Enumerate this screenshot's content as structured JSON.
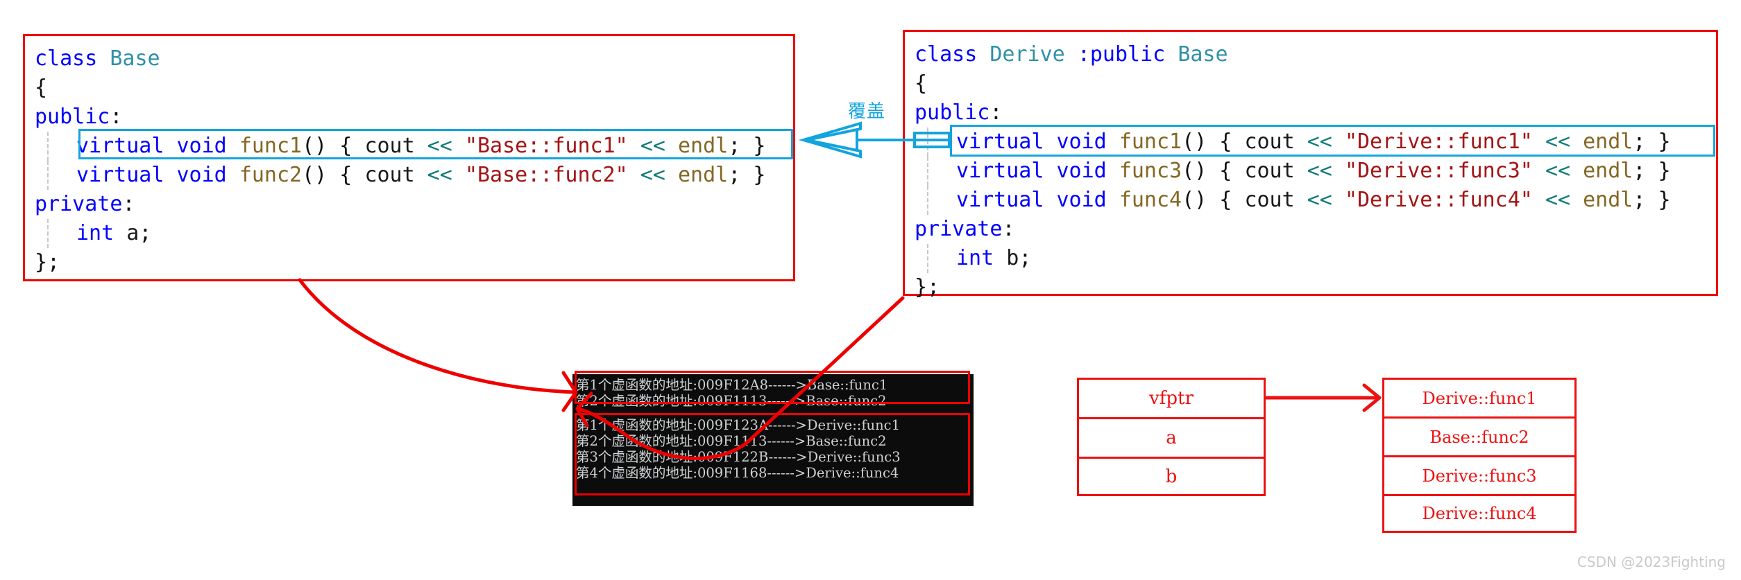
{
  "annotation": {
    "override_label": "覆盖",
    "accent_blue": "#13a4dd",
    "accent_red": "#ee0000"
  },
  "base_class": {
    "title": "class Base",
    "lines": [
      {
        "id": "l1",
        "tokens": [
          {
            "t": "class",
            "c": "kw"
          },
          {
            "t": " ",
            "c": "punc"
          },
          {
            "t": "Base",
            "c": "type"
          }
        ]
      },
      {
        "id": "l2",
        "tokens": [
          {
            "t": "{",
            "c": "punc"
          }
        ]
      },
      {
        "id": "l3",
        "tokens": [
          {
            "t": "public",
            "c": "kw"
          },
          {
            "t": ":",
            "c": "punc"
          }
        ]
      },
      {
        "id": "l4",
        "indent": true,
        "tokens": [
          {
            "t": "virtual",
            "c": "kw"
          },
          {
            "t": " ",
            "c": "punc"
          },
          {
            "t": "void",
            "c": "kw"
          },
          {
            "t": " ",
            "c": "punc"
          },
          {
            "t": "func1",
            "c": "fn"
          },
          {
            "t": "() { ",
            "c": "punc"
          },
          {
            "t": "cout",
            "c": "id"
          },
          {
            "t": " ",
            "c": "punc"
          },
          {
            "t": "<<",
            "c": "op"
          },
          {
            "t": " ",
            "c": "punc"
          },
          {
            "t": "\"Base::func1\"",
            "c": "str"
          },
          {
            "t": " ",
            "c": "punc"
          },
          {
            "t": "<<",
            "c": "op"
          },
          {
            "t": " ",
            "c": "punc"
          },
          {
            "t": "endl",
            "c": "endl"
          },
          {
            "t": "; }",
            "c": "punc"
          }
        ]
      },
      {
        "id": "l5",
        "indent": true,
        "tokens": [
          {
            "t": "virtual",
            "c": "kw"
          },
          {
            "t": " ",
            "c": "punc"
          },
          {
            "t": "void",
            "c": "kw"
          },
          {
            "t": " ",
            "c": "punc"
          },
          {
            "t": "func2",
            "c": "fn"
          },
          {
            "t": "() { ",
            "c": "punc"
          },
          {
            "t": "cout",
            "c": "id"
          },
          {
            "t": " ",
            "c": "punc"
          },
          {
            "t": "<<",
            "c": "op"
          },
          {
            "t": " ",
            "c": "punc"
          },
          {
            "t": "\"Base::func2\"",
            "c": "str"
          },
          {
            "t": " ",
            "c": "punc"
          },
          {
            "t": "<<",
            "c": "op"
          },
          {
            "t": " ",
            "c": "punc"
          },
          {
            "t": "endl",
            "c": "endl"
          },
          {
            "t": "; }",
            "c": "punc"
          }
        ]
      },
      {
        "id": "l6",
        "tokens": [
          {
            "t": "private",
            "c": "kw"
          },
          {
            "t": ":",
            "c": "punc"
          }
        ]
      },
      {
        "id": "l7",
        "indent": true,
        "tokens": [
          {
            "t": "int",
            "c": "kw"
          },
          {
            "t": " ",
            "c": "punc"
          },
          {
            "t": "a",
            "c": "id"
          },
          {
            "t": ";",
            "c": "punc"
          }
        ]
      },
      {
        "id": "l8",
        "tokens": [
          {
            "t": "};",
            "c": "punc"
          }
        ]
      }
    ]
  },
  "derive_class": {
    "title": "class Derive :public Base",
    "lines": [
      {
        "id": "r1",
        "tokens": [
          {
            "t": "class",
            "c": "kw"
          },
          {
            "t": " ",
            "c": "punc"
          },
          {
            "t": "Derive",
            "c": "type"
          },
          {
            "t": " ",
            "c": "punc"
          },
          {
            "t": ":public",
            "c": "kw"
          },
          {
            "t": " ",
            "c": "punc"
          },
          {
            "t": "Base",
            "c": "type"
          }
        ]
      },
      {
        "id": "r2",
        "tokens": [
          {
            "t": "{",
            "c": "punc"
          }
        ]
      },
      {
        "id": "r3",
        "tokens": [
          {
            "t": "public",
            "c": "kw"
          },
          {
            "t": ":",
            "c": "punc"
          }
        ]
      },
      {
        "id": "r4",
        "indent": true,
        "tokens": [
          {
            "t": "virtual",
            "c": "kw"
          },
          {
            "t": " ",
            "c": "punc"
          },
          {
            "t": "void",
            "c": "kw"
          },
          {
            "t": " ",
            "c": "punc"
          },
          {
            "t": "func1",
            "c": "fn"
          },
          {
            "t": "() { ",
            "c": "punc"
          },
          {
            "t": "cout",
            "c": "id"
          },
          {
            "t": " ",
            "c": "punc"
          },
          {
            "t": "<<",
            "c": "op"
          },
          {
            "t": " ",
            "c": "punc"
          },
          {
            "t": "\"Derive::func1\"",
            "c": "str"
          },
          {
            "t": " ",
            "c": "punc"
          },
          {
            "t": "<<",
            "c": "op"
          },
          {
            "t": " ",
            "c": "punc"
          },
          {
            "t": "endl",
            "c": "endl"
          },
          {
            "t": "; }",
            "c": "punc"
          }
        ]
      },
      {
        "id": "r5",
        "indent": true,
        "tokens": [
          {
            "t": "virtual",
            "c": "kw"
          },
          {
            "t": " ",
            "c": "punc"
          },
          {
            "t": "void",
            "c": "kw"
          },
          {
            "t": " ",
            "c": "punc"
          },
          {
            "t": "func3",
            "c": "fn"
          },
          {
            "t": "() { ",
            "c": "punc"
          },
          {
            "t": "cout",
            "c": "id"
          },
          {
            "t": " ",
            "c": "punc"
          },
          {
            "t": "<<",
            "c": "op"
          },
          {
            "t": " ",
            "c": "punc"
          },
          {
            "t": "\"Derive::func3\"",
            "c": "str"
          },
          {
            "t": " ",
            "c": "punc"
          },
          {
            "t": "<<",
            "c": "op"
          },
          {
            "t": " ",
            "c": "punc"
          },
          {
            "t": "endl",
            "c": "endl"
          },
          {
            "t": "; }",
            "c": "punc"
          }
        ]
      },
      {
        "id": "r6",
        "indent": true,
        "tokens": [
          {
            "t": "virtual",
            "c": "kw"
          },
          {
            "t": " ",
            "c": "punc"
          },
          {
            "t": "void",
            "c": "kw"
          },
          {
            "t": " ",
            "c": "punc"
          },
          {
            "t": "func4",
            "c": "fn"
          },
          {
            "t": "() { ",
            "c": "punc"
          },
          {
            "t": "cout",
            "c": "id"
          },
          {
            "t": " ",
            "c": "punc"
          },
          {
            "t": "<<",
            "c": "op"
          },
          {
            "t": " ",
            "c": "punc"
          },
          {
            "t": "\"Derive::func4\"",
            "c": "str"
          },
          {
            "t": " ",
            "c": "punc"
          },
          {
            "t": "<<",
            "c": "op"
          },
          {
            "t": " ",
            "c": "punc"
          },
          {
            "t": "endl",
            "c": "endl"
          },
          {
            "t": "; }",
            "c": "punc"
          }
        ]
      },
      {
        "id": "r7",
        "tokens": [
          {
            "t": "private",
            "c": "kw"
          },
          {
            "t": ":",
            "c": "punc"
          }
        ]
      },
      {
        "id": "r8",
        "indent": true,
        "tokens": [
          {
            "t": "int",
            "c": "kw"
          },
          {
            "t": " ",
            "c": "punc"
          },
          {
            "t": "b",
            "c": "id"
          },
          {
            "t": ";",
            "c": "punc"
          }
        ]
      },
      {
        "id": "r9",
        "tokens": [
          {
            "t": "};",
            "c": "punc"
          }
        ]
      }
    ]
  },
  "console": {
    "base_output": [
      "第1个虚函数的地址:009F12A8------>Base::func1",
      "第2个虚函数的地址:009F1113------>Base::func2"
    ],
    "derive_output": [
      "第1个虚函数的地址:009F123A------>Derive::func1",
      "第2个虚函数的地址:009F1113------>Base::func2",
      "第3个虚函数的地址:009F122B------>Derive::func3",
      "第4个虚函数的地址:009F1168------>Derive::func4"
    ]
  },
  "object_layout": {
    "cells": [
      "vfptr",
      "a",
      "b"
    ]
  },
  "vtable": {
    "cells": [
      "Derive::func1",
      "Base::func2",
      "Derive::func3",
      "Derive::func4"
    ]
  },
  "watermark": {
    "text": "CSDN @2023Fighting"
  }
}
